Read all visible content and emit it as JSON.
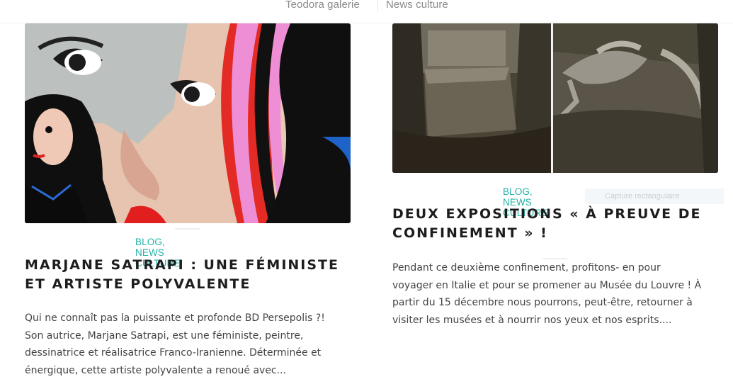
{
  "nav": {
    "items": [
      {
        "label": "Teodora galerie"
      },
      {
        "label": "News culture"
      }
    ]
  },
  "posts": [
    {
      "categories": "BLOG, NEWS CULTURE",
      "title_lines": [
        "MARJANE SATRAPI : UNE FÉMINISTE",
        "ET ARTISTE POLYVALENTE"
      ],
      "excerpt_lines": [
        "Qui ne connaît pas la puissante et profonde BD Persepolis ?!",
        "Son autrice, Marjane Satrapi, est une féministe, peintre,",
        "dessinatrice et réalisatrice Franco-Iranienne. Déterminée et",
        "énergique, cette artiste polyvalente a renoué avec..."
      ]
    },
    {
      "categories": "BLOG, NEWS CULTURE",
      "title_lines": [
        "DEUX EXPOSITIONS « À PREUVE DE",
        "CONFINEMENT » !"
      ],
      "excerpt_lines": [
        "Pendant ce deuxième confinement, profitons- en pour",
        "voyager en Italie et pour se promener au Musée du Louvre ! À",
        "partir du 15 décembre nous pourrons, peut-être, retourner à",
        "visiter les musées et à nourrir nos yeux et nos esprits...."
      ]
    }
  ],
  "overlay": {
    "label": "Capture rectangulaire"
  },
  "colors": {
    "accent": "#23b3a6",
    "title": "#1d1d1d",
    "text": "#444444",
    "nav": "#8a8a8a"
  }
}
